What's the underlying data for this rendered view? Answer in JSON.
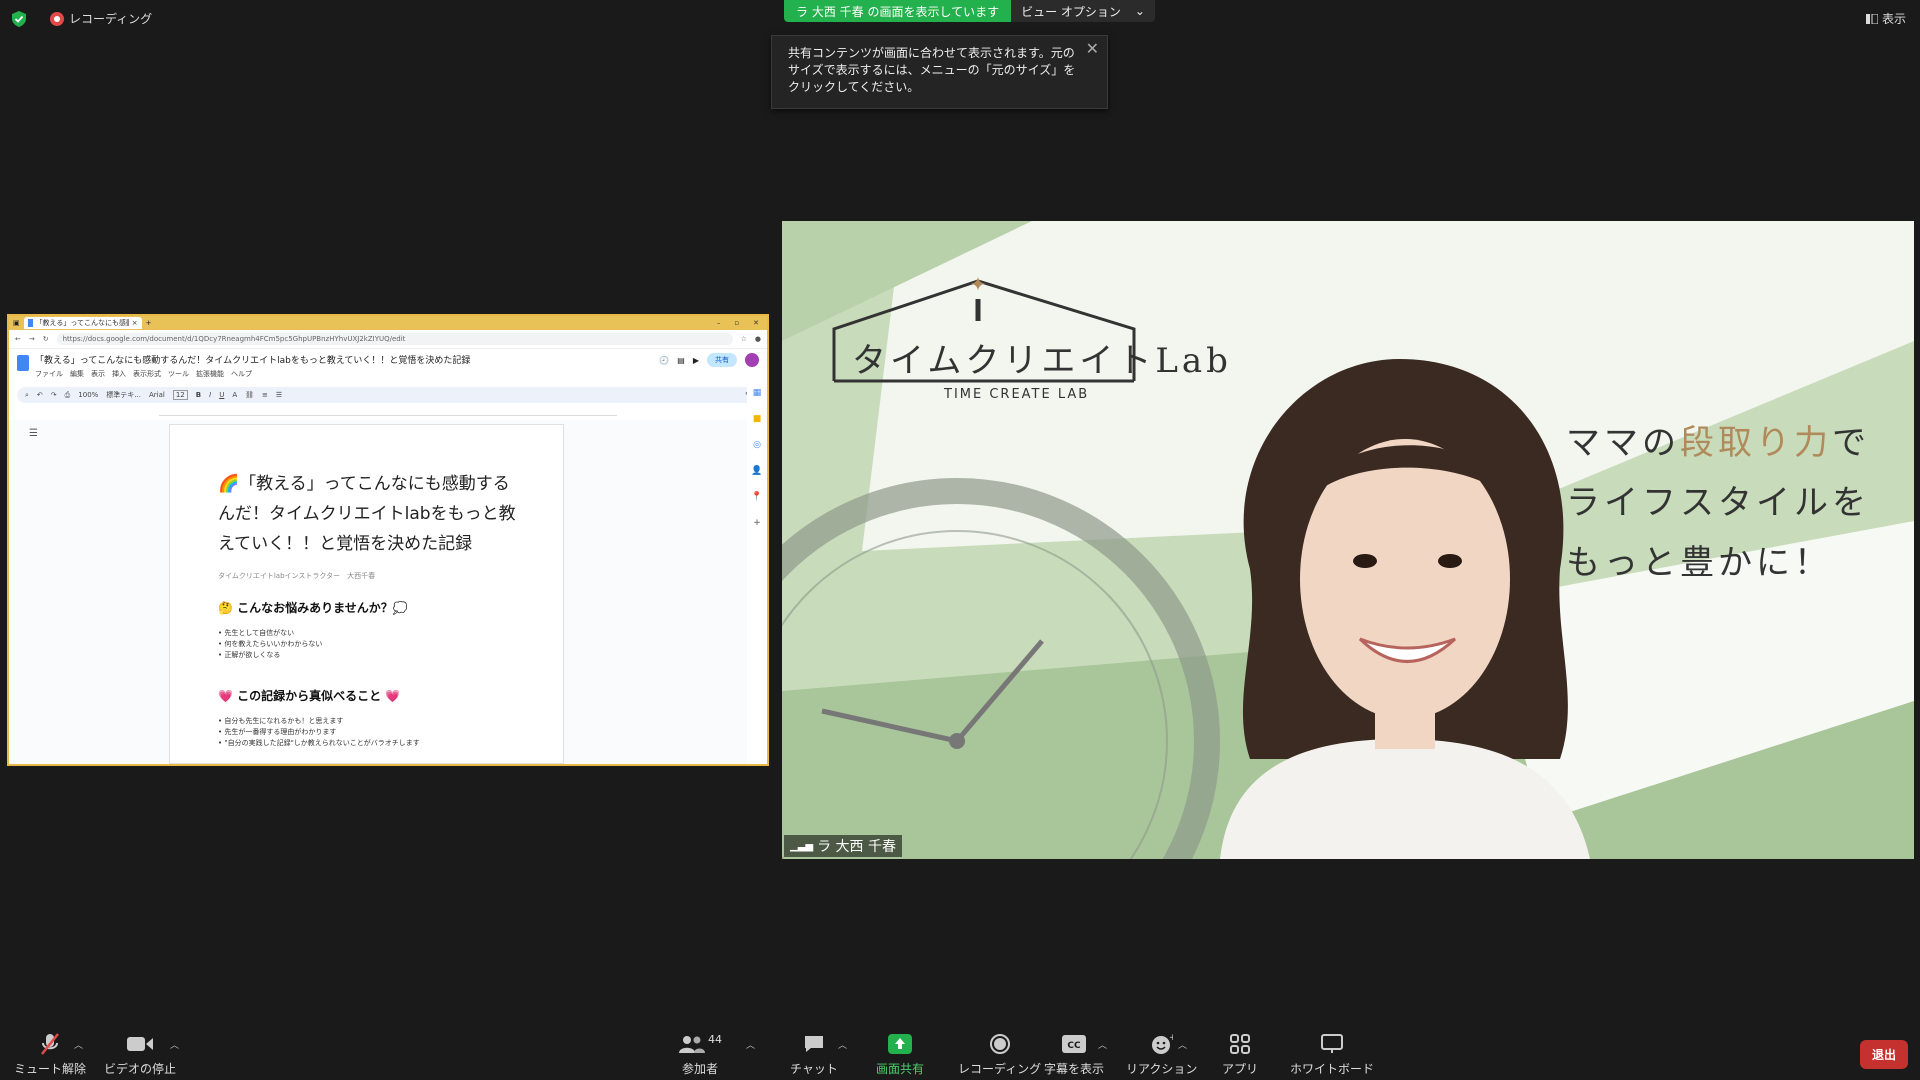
{
  "top": {
    "recording_label": "レコーディング",
    "share_banner": "ラ 大西 千春 の画面を表示しています",
    "view_options": "ビュー オプション",
    "tooltip": "共有コンテンツが画面に合わせて表示されます。元のサイズで表示するには、メニューの「元のサイズ」をクリックしてください。",
    "display_label": "表示"
  },
  "shared": {
    "tab_title": "「教える」ってこんなにも感動するんだ！",
    "url": "https://docs.google.com/document/d/1QDcy7Rneagmh4FCm5pc5GhpUPBnzHYhvUXJ2kZIYUQ/edit",
    "doc_title": "「教える」ってこんなにも感動するんだ！タイムクリエイトlabをもっと教えていく！！と覚悟を決めた記録",
    "menu": [
      "ファイル",
      "編集",
      "表示",
      "挿入",
      "表示形式",
      "ツール",
      "拡張機能",
      "ヘルプ"
    ],
    "share_btn": "共有",
    "toolbar": {
      "zoom": "100%",
      "style": "標準テキ...",
      "font": "Arial",
      "size": "12"
    },
    "heading": "🌈「教える」ってこんなにも感動するんだ！タイムクリエイトlabをもっと教えていく！！と覚悟を決めた記録",
    "subtitle": "タイムクリエイトlabインストラクター　大西千春",
    "section1": "🤔 こんなお悩みありませんか？💭",
    "list1": [
      "先生として自信がない",
      "何を教えたらいいかわからない",
      "正解が欲しくなる"
    ],
    "section2": "💗 この記録から真似べること 💗",
    "list2": [
      "自分も先生になれるかも！と思えます",
      "先生が一番得する理由がわかります",
      "\"自分の実践した記録\"しか教えられないことがバラオチします"
    ]
  },
  "video": {
    "logo_main": "タイムクリエイトLab",
    "logo_sub": "TIME CREATE LAB",
    "tagline1_a": "ママの",
    "tagline1_b": "段取り力",
    "tagline1_c": "で",
    "tagline2": "ライフスタイルを",
    "tagline3": "もっと豊かに！",
    "participant_name": "ラ 大西 千春"
  },
  "toolbar": {
    "mute": "ミュート解除",
    "video": "ビデオの停止",
    "participants": "参加者",
    "participants_count": "44",
    "chat": "チャット",
    "share": "画面共有",
    "record": "レコーディング",
    "captions": "字幕を表示",
    "reactions": "リアクション",
    "apps": "アプリ",
    "whiteboard": "ホワイトボード",
    "leave": "退出"
  },
  "colors": {
    "share_green": "#23b14d",
    "leave_red": "#c4312e",
    "accent_brown": "#b08a5a"
  }
}
